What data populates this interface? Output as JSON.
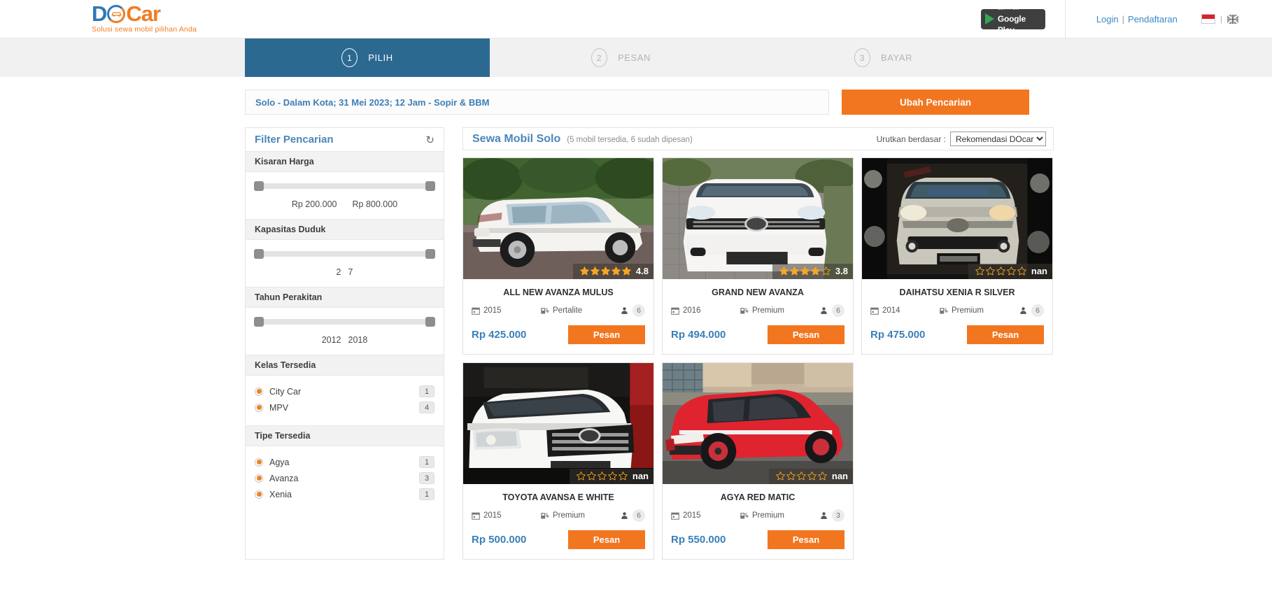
{
  "header": {
    "logo": {
      "part1": "D",
      "part2": "Car",
      "icon": "car-in-circle-icon",
      "tagline": "Solusi sewa mobil pilihan Anda"
    },
    "google_play": {
      "line1": "GET IT ON",
      "line2": "Google Play"
    },
    "login": "Login",
    "separator": "|",
    "register": "Pendaftaran",
    "flags": {
      "id": "indonesia-flag",
      "sep": "|",
      "en": "uk-flag"
    }
  },
  "stepper": {
    "steps": [
      {
        "num": "1",
        "label": "PILIH",
        "active": true
      },
      {
        "num": "2",
        "label": "PESAN",
        "active": false
      },
      {
        "num": "3",
        "label": "BAYAR",
        "active": false
      }
    ]
  },
  "search": {
    "summary": "Solo - Dalam Kota; 31 Mei 2023; 12 Jam - Sopir & BBM",
    "change_button": "Ubah Pencarian"
  },
  "filter": {
    "title": "Filter Pencarian",
    "refresh_icon": "refresh-icon",
    "price": {
      "heading": "Kisaran Harga",
      "min": "Rp 200.000",
      "max": "Rp 800.000"
    },
    "seats": {
      "heading": "Kapasitas Duduk",
      "min": "2",
      "max": "7"
    },
    "year": {
      "heading": "Tahun Perakitan",
      "min": "2012",
      "max": "2018"
    },
    "class": {
      "heading": "Kelas Tersedia",
      "items": [
        {
          "label": "City Car",
          "count": "1"
        },
        {
          "label": "MPV",
          "count": "4"
        }
      ]
    },
    "type": {
      "heading": "Tipe Tersedia",
      "items": [
        {
          "label": "Agya",
          "count": "1"
        },
        {
          "label": "Avanza",
          "count": "3"
        },
        {
          "label": "Xenia",
          "count": "1"
        }
      ]
    }
  },
  "results": {
    "title": "Sewa Mobil Solo",
    "subtitle": "(5 mobil tersedia, 6 sudah dipesan)",
    "sort_label": "Urutkan berdasar :",
    "sort_value": "Rekomendasi DOcar",
    "sort_options": [
      "Rekomendasi DOcar"
    ],
    "cards": [
      {
        "name": "ALL NEW AVANZA MULUS",
        "rating": "4.8",
        "stars_filled": 5,
        "year": "2015",
        "fuel": "Pertalite",
        "seats": "6",
        "price": "Rp 425.000",
        "button": "Pesan",
        "photo": "white-avanza-side-view"
      },
      {
        "name": "GRAND NEW AVANZA",
        "rating": "3.8",
        "stars_filled": 4,
        "year": "2016",
        "fuel": "Premium",
        "seats": "6",
        "price": "Rp 494.000",
        "button": "Pesan",
        "photo": "white-avanza-front-view"
      },
      {
        "name": "DAIHATSU XENIA R SILVER",
        "rating": "nan",
        "stars_filled": 0,
        "year": "2014",
        "fuel": "Premium",
        "seats": "6",
        "price": "Rp 475.000",
        "button": "Pesan",
        "photo": "silver-xenia-front-view"
      },
      {
        "name": "TOYOTA AVANSA E WHITE",
        "rating": "nan",
        "stars_filled": 0,
        "year": "2015",
        "fuel": "Premium",
        "seats": "6",
        "price": "Rp 500.000",
        "button": "Pesan",
        "photo": "white-avanza-garage-view"
      },
      {
        "name": "AGYA RED MATIC",
        "rating": "nan",
        "stars_filled": 0,
        "year": "2015",
        "fuel": "Premium",
        "seats": "3",
        "price": "Rp 550.000",
        "button": "Pesan",
        "photo": "red-agya-side-view"
      }
    ]
  },
  "colors": {
    "accent_orange": "#f2761f",
    "brand_blue": "#2f78b5",
    "step_active": "#2b6991",
    "star_gold": "#f5a623"
  }
}
